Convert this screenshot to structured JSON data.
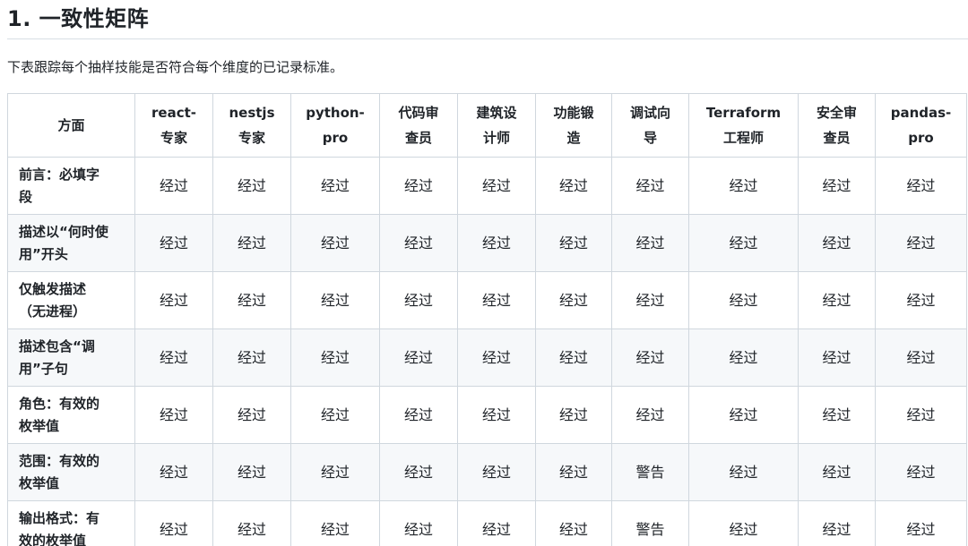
{
  "heading": "1. 一致性矩阵",
  "intro": "下表跟踪每个抽样技能是否符合每个维度的已记录标准。",
  "table": {
    "columns": [
      "方面",
      "react-专家",
      "nestjs专家",
      "python-pro",
      "代码审查员",
      "建筑设计师",
      "功能锻造",
      "调试向导",
      "Terraform工程师",
      "安全审查员",
      "pandas-pro"
    ],
    "column_lines": [
      [
        "方面"
      ],
      [
        "react-",
        "专家"
      ],
      [
        "nestjs",
        "专家"
      ],
      [
        "python-",
        "pro"
      ],
      [
        "代码审",
        "查员"
      ],
      [
        "建筑设",
        "计师"
      ],
      [
        "功能锻",
        "造"
      ],
      [
        "调试向",
        "导"
      ],
      [
        "Terraform",
        "工程师"
      ],
      [
        "安全审",
        "查员"
      ],
      [
        "pandas-",
        "pro"
      ]
    ],
    "rows": [
      {
        "dimension": "前言：必填字段",
        "lines": [
          "前言：必填字",
          "段"
        ],
        "cells": [
          "经过",
          "经过",
          "经过",
          "经过",
          "经过",
          "经过",
          "经过",
          "经过",
          "经过",
          "经过"
        ]
      },
      {
        "dimension": "描述以“何时使用”开头",
        "lines": [
          "描述以“何时使",
          "用”开头"
        ],
        "cells": [
          "经过",
          "经过",
          "经过",
          "经过",
          "经过",
          "经过",
          "经过",
          "经过",
          "经过",
          "经过"
        ]
      },
      {
        "dimension": "仅触发描述（无进程）",
        "lines": [
          "仅触发描述",
          "（无进程）"
        ],
        "cells": [
          "经过",
          "经过",
          "经过",
          "经过",
          "经过",
          "经过",
          "经过",
          "经过",
          "经过",
          "经过"
        ]
      },
      {
        "dimension": "描述包含“调用”子句",
        "lines": [
          "描述包含“调",
          "用”子句"
        ],
        "cells": [
          "经过",
          "经过",
          "经过",
          "经过",
          "经过",
          "经过",
          "经过",
          "经过",
          "经过",
          "经过"
        ]
      },
      {
        "dimension": "角色：有效的枚举值",
        "lines": [
          "角色：有效的",
          "枚举值"
        ],
        "cells": [
          "经过",
          "经过",
          "经过",
          "经过",
          "经过",
          "经过",
          "经过",
          "经过",
          "经过",
          "经过"
        ]
      },
      {
        "dimension": "范围：有效的枚举值",
        "lines": [
          "范围：有效的",
          "枚举值"
        ],
        "cells": [
          "经过",
          "经过",
          "经过",
          "经过",
          "经过",
          "经过",
          "警告",
          "经过",
          "经过",
          "经过"
        ]
      },
      {
        "dimension": "输出格式：有效的枚举值",
        "lines": [
          "输出格式：有",
          "效的枚举值"
        ],
        "cells": [
          "经过",
          "经过",
          "经过",
          "经过",
          "经过",
          "经过",
          "警告",
          "经过",
          "经过",
          "经过"
        ]
      }
    ]
  }
}
